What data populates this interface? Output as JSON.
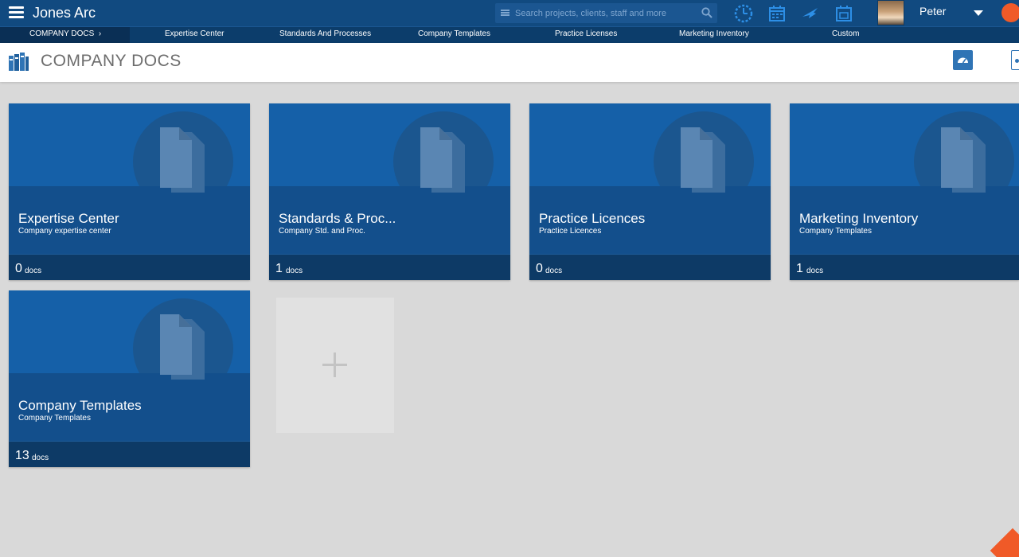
{
  "app": {
    "title": "Jones Arc"
  },
  "search": {
    "placeholder": "Search projects, clients, staff and more"
  },
  "user": {
    "name": "Peter"
  },
  "nav": {
    "active": "COMPANY DOCS",
    "items": [
      "Expertise Center",
      "Standards And Processes",
      "Company Templates",
      "Practice Licenses",
      "Marketing Inventory",
      "Custom"
    ]
  },
  "header": {
    "title": "COMPANY DOCS"
  },
  "cards": [
    {
      "title": "Expertise Center",
      "subtitle": "Company expertise center",
      "count": "0",
      "unit": "docs"
    },
    {
      "title": "Standards & Proc...",
      "subtitle": "Company Std. and Proc.",
      "count": "1",
      "unit": "docs"
    },
    {
      "title": "Practice Licences",
      "subtitle": "Practice Licences",
      "count": "0",
      "unit": "docs"
    },
    {
      "title": "Marketing Inventory",
      "subtitle": "Company Templates",
      "count": "1",
      "unit": "docs"
    },
    {
      "title": "Company Templates",
      "subtitle": "Company Templates",
      "count": "13",
      "unit": "docs"
    }
  ],
  "icons": {
    "menu": "hamburger-icon",
    "search": "search-icon",
    "timer": "timer-icon",
    "calendar": "calendar-icon",
    "leave": "plane-icon",
    "date": "date-icon",
    "books": "books-icon",
    "dashboard": "dashboard-icon",
    "add": "plus-icon"
  },
  "colors": {
    "topbar": "#114a80",
    "accent": "#1560a8",
    "badge": "#f05a28"
  }
}
